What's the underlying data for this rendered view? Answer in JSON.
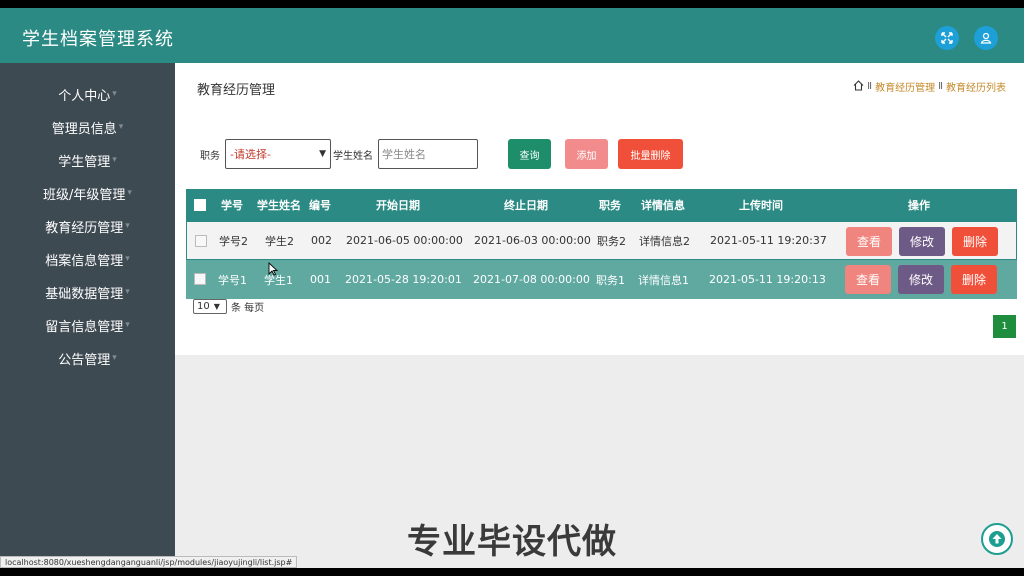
{
  "app": {
    "title": "学生档案管理系统"
  },
  "header": {
    "icons": [
      "fullscreen-icon",
      "user-icon"
    ]
  },
  "sidebar": {
    "items": [
      {
        "label": "个人中心"
      },
      {
        "label": "管理员信息"
      },
      {
        "label": "学生管理"
      },
      {
        "label": "班级/年级管理"
      },
      {
        "label": "教育经历管理"
      },
      {
        "label": "档案信息管理"
      },
      {
        "label": "基础数据管理"
      },
      {
        "label": "留言信息管理"
      },
      {
        "label": "公告管理"
      }
    ]
  },
  "main": {
    "title": "教育经历管理",
    "breadcrumb": [
      "教育经历管理",
      "教育经历列表"
    ],
    "breadcrumb_sep": "Ⅱ"
  },
  "search": {
    "role_label": "职务",
    "role_value": "-请选择-",
    "name_label": "学生姓名",
    "name_placeholder": "学生姓名",
    "query_btn": "查询",
    "add_btn": "添加",
    "batch_delete_btn": "批量删除"
  },
  "table": {
    "headers": [
      "学号",
      "学生姓名",
      "编号",
      "开始日期",
      "终止日期",
      "职务",
      "详情信息",
      "上传时间",
      "操作"
    ],
    "rows": [
      [
        "学号2",
        "学生2",
        "002",
        "2021-06-05 00:00:00",
        "2021-06-03 00:00:00",
        "职务2",
        "详情信息2",
        "2021-05-11 19:20:37"
      ],
      [
        "学号1",
        "学生1",
        "001",
        "2021-05-28 19:20:01",
        "2021-07-08 00:00:00",
        "职务1",
        "详情信息1",
        "2021-05-11 19:20:13"
      ]
    ],
    "actions": {
      "view": "查看",
      "edit": "修改",
      "delete": "删除"
    }
  },
  "pagination": {
    "page_size": "10",
    "per_page_label": "条 每页",
    "current_page": "1"
  },
  "watermark": "专业毕设代做",
  "status_url": "localhost:8080/xueshengdanganguanli/jsp/modules/jiaoyujingli/list.jsp#",
  "colors": {
    "header": "#2b8a84",
    "sidebar": "#3e4a52",
    "view": "#f0857f",
    "edit": "#6e5a86",
    "delete": "#f0503a",
    "query": "#1e8e6a",
    "add": "#f28c8c",
    "batch_delete": "#f0503a"
  }
}
